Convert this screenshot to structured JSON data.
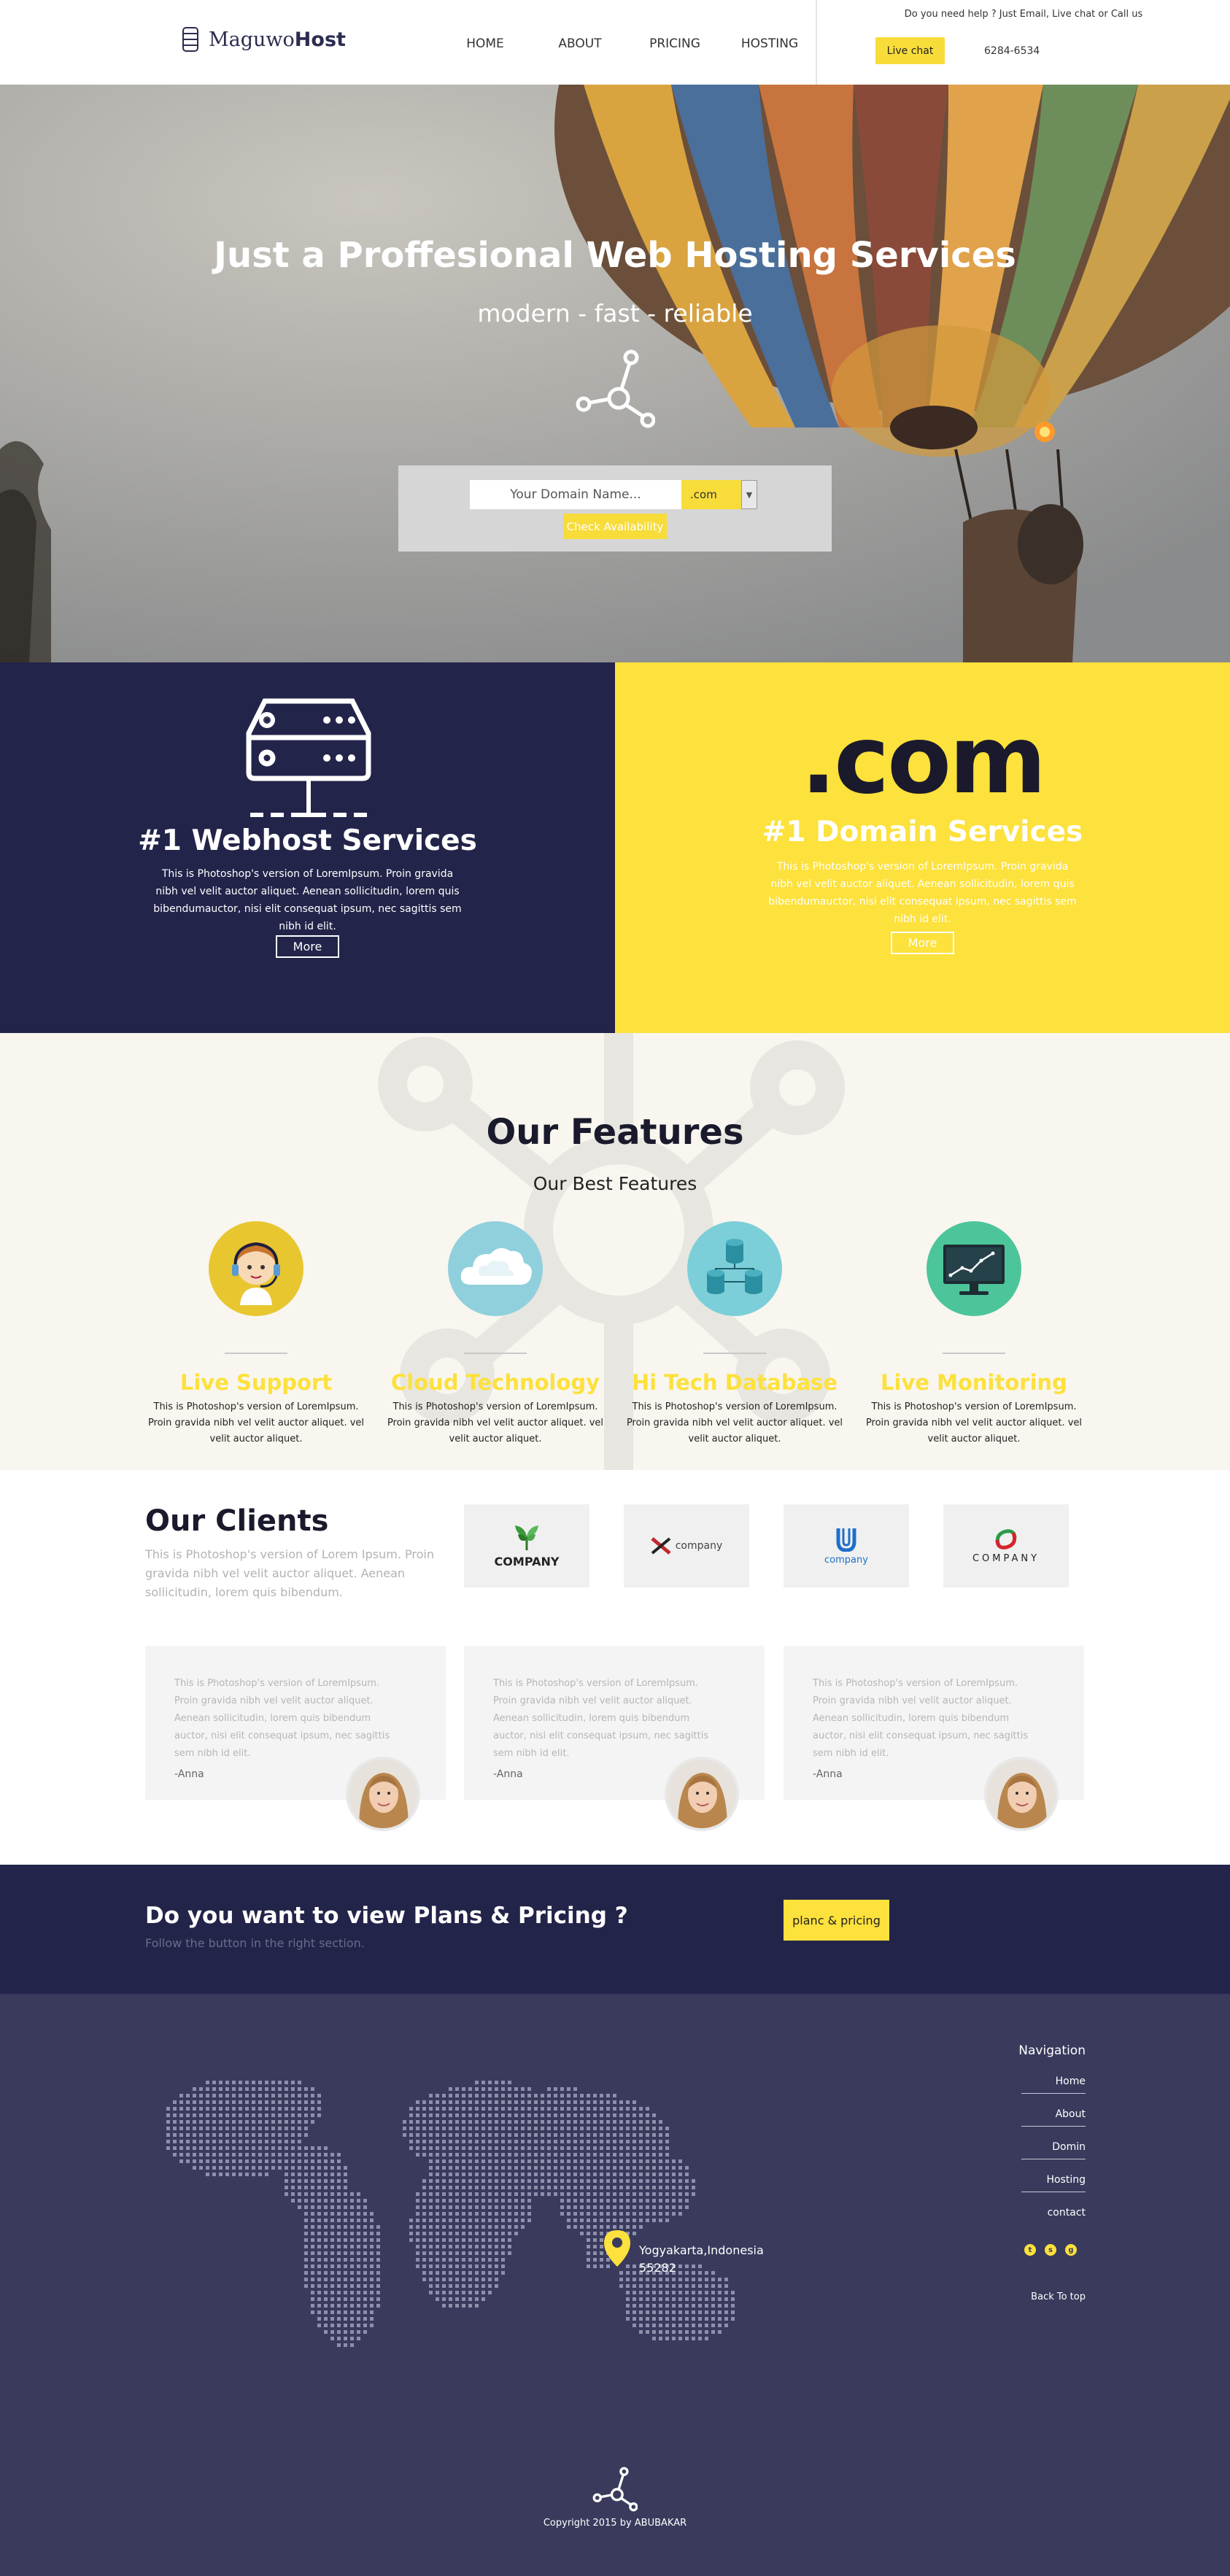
{
  "header": {
    "logo_light": "Maguwo",
    "logo_bold": "Host",
    "nav": [
      {
        "label": "HOME"
      },
      {
        "label": "ABOUT"
      },
      {
        "label": "PRICING"
      },
      {
        "label": "HOSTING"
      }
    ],
    "help_text": "Do you need help ? Just Email, Live chat or Call us",
    "livechat_label": "Live chat",
    "phone": "6284-6534"
  },
  "hero": {
    "title": "Just a Proffesional Web Hosting Services",
    "subtitle": "modern - fast - reliable",
    "domain_placeholder": "Your Domain Name...",
    "tld": ".com",
    "check_label": "Check Availability"
  },
  "services": {
    "webhost": {
      "title": "#1 Webhost Services",
      "text": "This is Photoshop's version of LoremIpsum. Proin gravida nibh vel velit auctor aliquet. Aenean sollicitudin, lorem quis bibendumauctor, nisi elit consequat ipsum, nec sagittis sem nibh id elit.",
      "more": "More"
    },
    "domain": {
      "big": ".com",
      "title": "#1 Domain Services",
      "text": "This is Photoshop's version of LoremIpsum. Proin gravida nibh vel velit auctor aliquet. Aenean sollicitudin, lorem quis bibendumauctor, nisi elit consequat ipsum, nec sagittis sem nibh id elit.",
      "more": "More"
    }
  },
  "features": {
    "title": "Our Features",
    "subtitle": "Our Best Features",
    "items": [
      {
        "title": "Live Support",
        "text": "This is Photoshop's version of LoremIpsum. Proin gravida nibh vel velit auctor aliquet. vel velit auctor aliquet.",
        "icon": "headset-agent-icon",
        "color": "#e8c630"
      },
      {
        "title": "Cloud Technology",
        "text": "This is Photoshop's version of LoremIpsum. Proin gravida nibh vel velit auctor aliquet. vel velit auctor aliquet.",
        "icon": "cloud-icon",
        "color": "#8fd0dc"
      },
      {
        "title": "Hi Tech Database",
        "text": "This is Photoshop's version of LoremIpsum. Proin gravida nibh vel velit auctor aliquet. vel velit auctor aliquet.",
        "icon": "database-icon",
        "color": "#7ccfd8"
      },
      {
        "title": "Live Monitoring",
        "text": "This is Photoshop's version of LoremIpsum. Proin gravida nibh vel velit auctor aliquet. vel velit auctor aliquet.",
        "icon": "monitor-chart-icon",
        "color": "#4dc59a"
      }
    ]
  },
  "clients": {
    "title": "Our Clients",
    "text": "This is Photoshop's version of Lorem Ipsum. Proin gravida nibh vel velit auctor aliquet. Aenean sollicitudin, lorem quis bibendum.",
    "logos": [
      {
        "name": "COMPANY",
        "icon": "leaf-logo-icon"
      },
      {
        "name": "company",
        "icon": "x-logo-icon"
      },
      {
        "name": "company",
        "icon": "u-logo-icon"
      },
      {
        "name": "COMPANY",
        "icon": "swirl-logo-icon"
      }
    ]
  },
  "testimonials": [
    {
      "text": "This is Photoshop's version of LoremIpsum. Proin gravida nibh vel velit auctor aliquet. Aenean sollicitudin, lorem quis bibendum auctor, nisi elit consequat ipsum, nec sagittis sem nibh id elit.",
      "author": "-Anna"
    },
    {
      "text": "This is Photoshop's version of LoremIpsum. Proin gravida nibh vel velit auctor aliquet. Aenean sollicitudin, lorem quis bibendum auctor, nisi elit consequat ipsum, nec sagittis sem nibh id elit.",
      "author": "-Anna"
    },
    {
      "text": "This is Photoshop's version of LoremIpsum. Proin gravida nibh vel velit auctor aliquet. Aenean sollicitudin, lorem quis bibendum auctor, nisi elit consequat ipsum, nec sagittis sem nibh id elit.",
      "author": "-Anna"
    }
  ],
  "cta": {
    "title": "Do you want to view Plans & Pricing ?",
    "subtitle": "Follow the button in the right section.",
    "button": "planc & pricing"
  },
  "footer": {
    "address_line1": "Yogyakarta,Indonesia",
    "address_line2": "55282",
    "nav_title": "Navigation",
    "nav": [
      {
        "label": "Home"
      },
      {
        "label": "About"
      },
      {
        "label": "Domin"
      },
      {
        "label": "Hosting"
      },
      {
        "label": "contact"
      }
    ],
    "social": [
      "twitter-icon",
      "skype-icon",
      "google-plus-icon"
    ],
    "back_to_top": "Back To top",
    "copyright": "Copyright 2015 by ABUBAKAR"
  },
  "colors": {
    "navy": "#23244a",
    "footer": "#393a5c",
    "yellow": "#fde13c",
    "cream": "#f8f6ef"
  }
}
